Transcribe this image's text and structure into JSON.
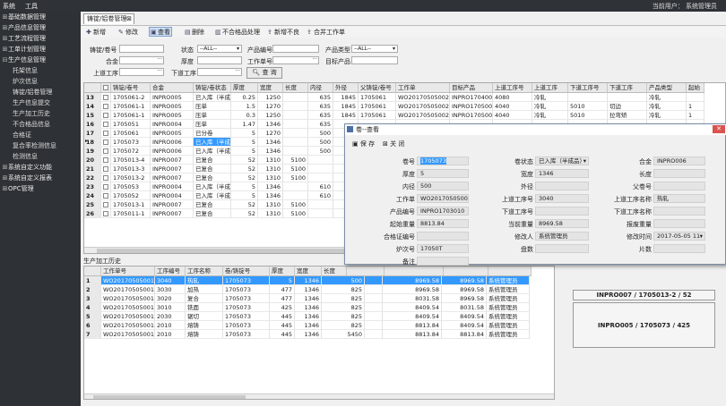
{
  "topbar": {
    "menu_system": "系统",
    "menu_tools": "工具",
    "current_user": "当前用户：  系统管理员"
  },
  "sidebar": {
    "items": [
      {
        "label": "基础数据管理",
        "expanded": false
      },
      {
        "label": "产品信息管理",
        "expanded": false
      },
      {
        "label": "工艺流程管理",
        "expanded": false
      },
      {
        "label": "工单计划管理",
        "expanded": false
      },
      {
        "label": "生产信息管理",
        "expanded": true
      }
    ],
    "subitems": [
      "托架信息",
      "炉次信息",
      "铸锭/铝卷管理",
      "生产信息提交",
      "生产加工历史",
      "不合格品信息",
      "合格证",
      "复合率检测信息",
      "检测信息"
    ],
    "bottom_items": [
      {
        "label": "系统自定义功能"
      },
      {
        "label": "系统自定义报表"
      },
      {
        "label": "OPC管理"
      }
    ]
  },
  "tab": {
    "label": "铸锭/铝卷管理"
  },
  "toolbar": [
    "新增",
    "修改",
    "查看",
    "删除",
    "不合格品处理",
    "新增不良",
    "合并工作单"
  ],
  "filters": {
    "ingot_no": "铸锭/卷号",
    "status": "状态",
    "status_value": "--ALL--",
    "product_no": "产品编号",
    "product_type": "产品类型",
    "product_type_value": "--ALL--",
    "alloy": "合金",
    "thickness": "厚度",
    "work_order": "工作单号",
    "target_product": "目标产品",
    "prev_proc": "上道工序",
    "next_proc": "下道工序",
    "query": "查 询"
  },
  "grid1": {
    "headers": [
      "",
      "铸锭/卷号",
      "合金",
      "铸锭/卷状态",
      "厚度",
      "宽度",
      "长度",
      "内径",
      "外径",
      "父铸锭/卷号",
      "工作单",
      "目标产品",
      "上道工序号",
      "上道工序",
      "下道工序号",
      "下道工序",
      "产品类型",
      "起始"
    ],
    "rows": [
      {
        "n": "13",
        "c": [
          "1705061-2",
          "INPRO005",
          "已入库（半成品）",
          "0.25",
          "1250",
          "",
          "635",
          "1845",
          "1705061",
          "WO201705050020",
          "INPRO1704007",
          "4080",
          "冷轧",
          "",
          "",
          "冷轧",
          ""
        ]
      },
      {
        "n": "14",
        "c": [
          "1705061-1",
          "INPRO005",
          "压单",
          "1.5",
          "1270",
          "",
          "635",
          "1845",
          "1705061",
          "WO201705050027",
          "INPRO1705006",
          "4040",
          "冷轧",
          "5010",
          "切边",
          "冷轧",
          "1"
        ]
      },
      {
        "n": "15",
        "c": [
          "1705061-1",
          "INPRO005",
          "压单",
          "0.3",
          "1250",
          "",
          "635",
          "1845",
          "1705061",
          "WO201705050025",
          "INPRO1705005",
          "4040",
          "冷轧",
          "5010",
          "拉弯矫",
          "冷轧",
          "1"
        ]
      },
      {
        "n": "16",
        "c": [
          "1705051",
          "INPRO004",
          "压单",
          "1.47",
          "1346",
          "",
          "635",
          "",
          "",
          "",
          "",
          "",
          "",
          "",
          "",
          "",
          ""
        ]
      },
      {
        "n": "17",
        "c": [
          "1705061",
          "INPRO005",
          "已分卷",
          "5",
          "1270",
          "",
          "500",
          "",
          "",
          "",
          "",
          "",
          "",
          "",
          "",
          "",
          ""
        ]
      },
      {
        "n": "18",
        "c": [
          "1705073",
          "INPRO006",
          "已入库（半成品）",
          "5",
          "1346",
          "",
          "500",
          "",
          "",
          "",
          "",
          "",
          "",
          "",
          "",
          "",
          ""
        ]
      },
      {
        "n": "19",
        "c": [
          "1705072",
          "INPRO006",
          "已入库（半成品）",
          "5",
          "1346",
          "",
          "500",
          "",
          "",
          "",
          "",
          "",
          "",
          "",
          "",
          "",
          ""
        ]
      },
      {
        "n": "20",
        "c": [
          "1705013-4",
          "INPRO007",
          "已复合",
          "52",
          "1310",
          "5100",
          "",
          "",
          "",
          "",
          "",
          "",
          "",
          "",
          "",
          "",
          ""
        ]
      },
      {
        "n": "21",
        "c": [
          "1705013-3",
          "INPRO007",
          "已复合",
          "52",
          "1310",
          "5100",
          "",
          "",
          "",
          "",
          "",
          "",
          "",
          "",
          "",
          "",
          ""
        ]
      },
      {
        "n": "22",
        "c": [
          "1705013-2",
          "INPRO007",
          "已复合",
          "52",
          "1310",
          "5100",
          "",
          "",
          "",
          "",
          "",
          "",
          "",
          "",
          "",
          "",
          ""
        ]
      },
      {
        "n": "23",
        "c": [
          "1705053",
          "INPRO004",
          "已入库（半成品）",
          "5",
          "1346",
          "",
          "610",
          "",
          "",
          "",
          "",
          "",
          "",
          "",
          "",
          "",
          ""
        ]
      },
      {
        "n": "24",
        "c": [
          "1705052",
          "INPRO004",
          "已入库（半成品）",
          "5",
          "1346",
          "",
          "610",
          "",
          "",
          "",
          "",
          "",
          "",
          "",
          "",
          "",
          ""
        ]
      },
      {
        "n": "25",
        "c": [
          "1705013-1",
          "INPRO007",
          "已复合",
          "52",
          "1310",
          "5100",
          "",
          "",
          "",
          "",
          "",
          "",
          "",
          "",
          "",
          "",
          ""
        ]
      },
      {
        "n": "26",
        "c": [
          "1705011-1",
          "INPRO007",
          "已复合",
          "52",
          "1310",
          "5100",
          "",
          "",
          "",
          "",
          "",
          "",
          "",
          "",
          "",
          "",
          ""
        ]
      }
    ]
  },
  "history": {
    "title": "生产加工历史",
    "headers": [
      "",
      "工作单号",
      "工序编号",
      "工序名称",
      "卷/铸锭号",
      "厚度",
      "宽度",
      "长度",
      "",
      "",
      "",
      ""
    ],
    "rows": [
      {
        "n": "1",
        "c": [
          "WO201705050017",
          "3040",
          "热轧",
          "1705073",
          "5",
          "1346",
          "500",
          "",
          "8969.58",
          "8969.58",
          "系统管理员"
        ]
      },
      {
        "n": "2",
        "c": [
          "WO201705050017",
          "3030",
          "加热",
          "1705073",
          "477",
          "1346",
          "825",
          "",
          "8969.58",
          "8969.58",
          "系统管理员"
        ]
      },
      {
        "n": "3",
        "c": [
          "WO201705050017",
          "3020",
          "复合",
          "1705073",
          "477",
          "1346",
          "825",
          "",
          "8031.58",
          "8969.58",
          "系统管理员"
        ]
      },
      {
        "n": "4",
        "c": [
          "WO201705050017",
          "3010",
          "铣面",
          "1705073",
          "425",
          "1346",
          "825",
          "",
          "8409.54",
          "8031.58",
          "系统管理员"
        ]
      },
      {
        "n": "5",
        "c": [
          "WO201705050013",
          "2030",
          "锯切",
          "1705073",
          "445",
          "1346",
          "825",
          "",
          "8409.54",
          "8409.54",
          "系统管理员"
        ]
      },
      {
        "n": "6",
        "c": [
          "WO201705050013",
          "2010",
          "熔铸",
          "1705073",
          "445",
          "1346",
          "825",
          "",
          "8813.84",
          "8409.54",
          "系统管理员"
        ]
      },
      {
        "n": "7",
        "c": [
          "WO201705050013",
          "2010",
          "熔铸",
          "1705073",
          "445",
          "1346",
          "5450",
          "",
          "8813.84",
          "8813.84",
          "系统管理员"
        ]
      }
    ]
  },
  "right_buttons": [
    "INPRO007 / 1705013-2 / 52",
    "INPRO005 / 1705073 / 425"
  ],
  "dialog": {
    "title": "卷--查看",
    "save": "保 存",
    "close": "关 闭",
    "fields": {
      "coil_no": {
        "label": "卷号",
        "value": "1705073"
      },
      "coil_status": {
        "label": "卷状态",
        "value": "已入库（半成品）"
      },
      "alloy": {
        "label": "合金",
        "value": "INPRO006"
      },
      "thickness": {
        "label": "厚度",
        "value": "5"
      },
      "width": {
        "label": "宽度",
        "value": "1346"
      },
      "length": {
        "label": "长度",
        "value": ""
      },
      "inner": {
        "label": "内径",
        "value": "500"
      },
      "outer": {
        "label": "外径",
        "value": ""
      },
      "parent": {
        "label": "父卷号",
        "value": ""
      },
      "work_order": {
        "label": "工作单",
        "value": "WO201705050017"
      },
      "prev_proc_no": {
        "label": "上道工序号",
        "value": "3040"
      },
      "prev_proc_name": {
        "label": "上道工序名称",
        "value": "热轧"
      },
      "product_no": {
        "label": "产品编号",
        "value": "INPRO1703010"
      },
      "next_proc_no": {
        "label": "下道工序号",
        "value": ""
      },
      "next_proc_name": {
        "label": "下道工序名称",
        "value": ""
      },
      "start_weight": {
        "label": "起始重量",
        "value": "8813.84"
      },
      "current_weight": {
        "label": "当前重量",
        "value": "8969.58"
      },
      "scrap_weight": {
        "label": "报废重量",
        "value": ""
      },
      "cert_no": {
        "label": "合格证编号",
        "value": ""
      },
      "modifier": {
        "label": "修改人",
        "value": "系统管理员"
      },
      "modify_time": {
        "label": "修改时间",
        "value": "2017-05-05 11:"
      },
      "furnace_no": {
        "label": "炉次号",
        "value": "17050T"
      },
      "count": {
        "label": "盘数",
        "value": ""
      },
      "pieces": {
        "label": "片数",
        "value": ""
      },
      "remark": {
        "label": "备注",
        "value": ""
      }
    }
  }
}
